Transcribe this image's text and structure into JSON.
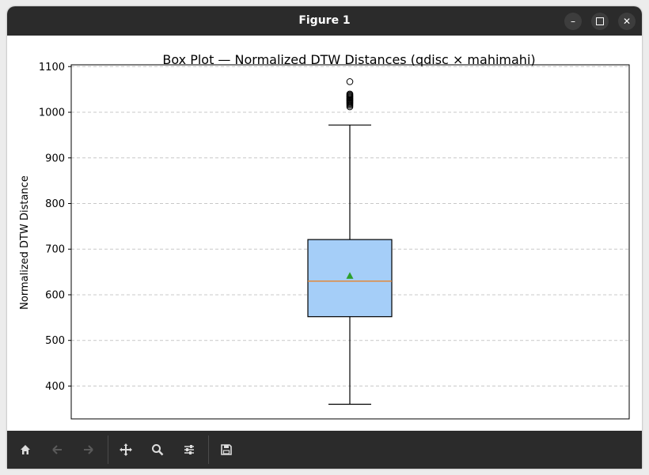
{
  "window": {
    "title": "Figure 1"
  },
  "toolbar": {
    "tools": [
      {
        "name": "home-icon",
        "enabled": true
      },
      {
        "name": "back-icon",
        "enabled": false
      },
      {
        "name": "forward-icon",
        "enabled": false
      },
      {
        "name": "pan-icon",
        "enabled": true
      },
      {
        "name": "zoom-icon",
        "enabled": true
      },
      {
        "name": "configure-subplots-icon",
        "enabled": true
      },
      {
        "name": "save-icon",
        "enabled": true
      }
    ]
  },
  "chart_data": {
    "type": "box",
    "title": "Box Plot — Normalized DTW Distances (qdisc × mahimahi)",
    "xlabel": "",
    "ylabel": "Normalized DTW Distance",
    "ylim": [
      328,
      1104
    ],
    "yticks": [
      400,
      500,
      600,
      700,
      800,
      900,
      1000,
      1100
    ],
    "grid": "y-dashed",
    "series": [
      {
        "whisker_low": 360,
        "q1": 552,
        "median": 630,
        "q3": 721,
        "whisker_high": 972,
        "mean": 641,
        "outliers": [
          1012,
          1015,
          1018,
          1020,
          1022,
          1024,
          1026,
          1028,
          1030,
          1032,
          1034,
          1036,
          1038,
          1040,
          1067
        ]
      }
    ],
    "colors": {
      "box_fill": "#a5cef8",
      "median": "#e8822a",
      "mean": "#2ca02c",
      "grid": "#c8c8c8"
    }
  }
}
